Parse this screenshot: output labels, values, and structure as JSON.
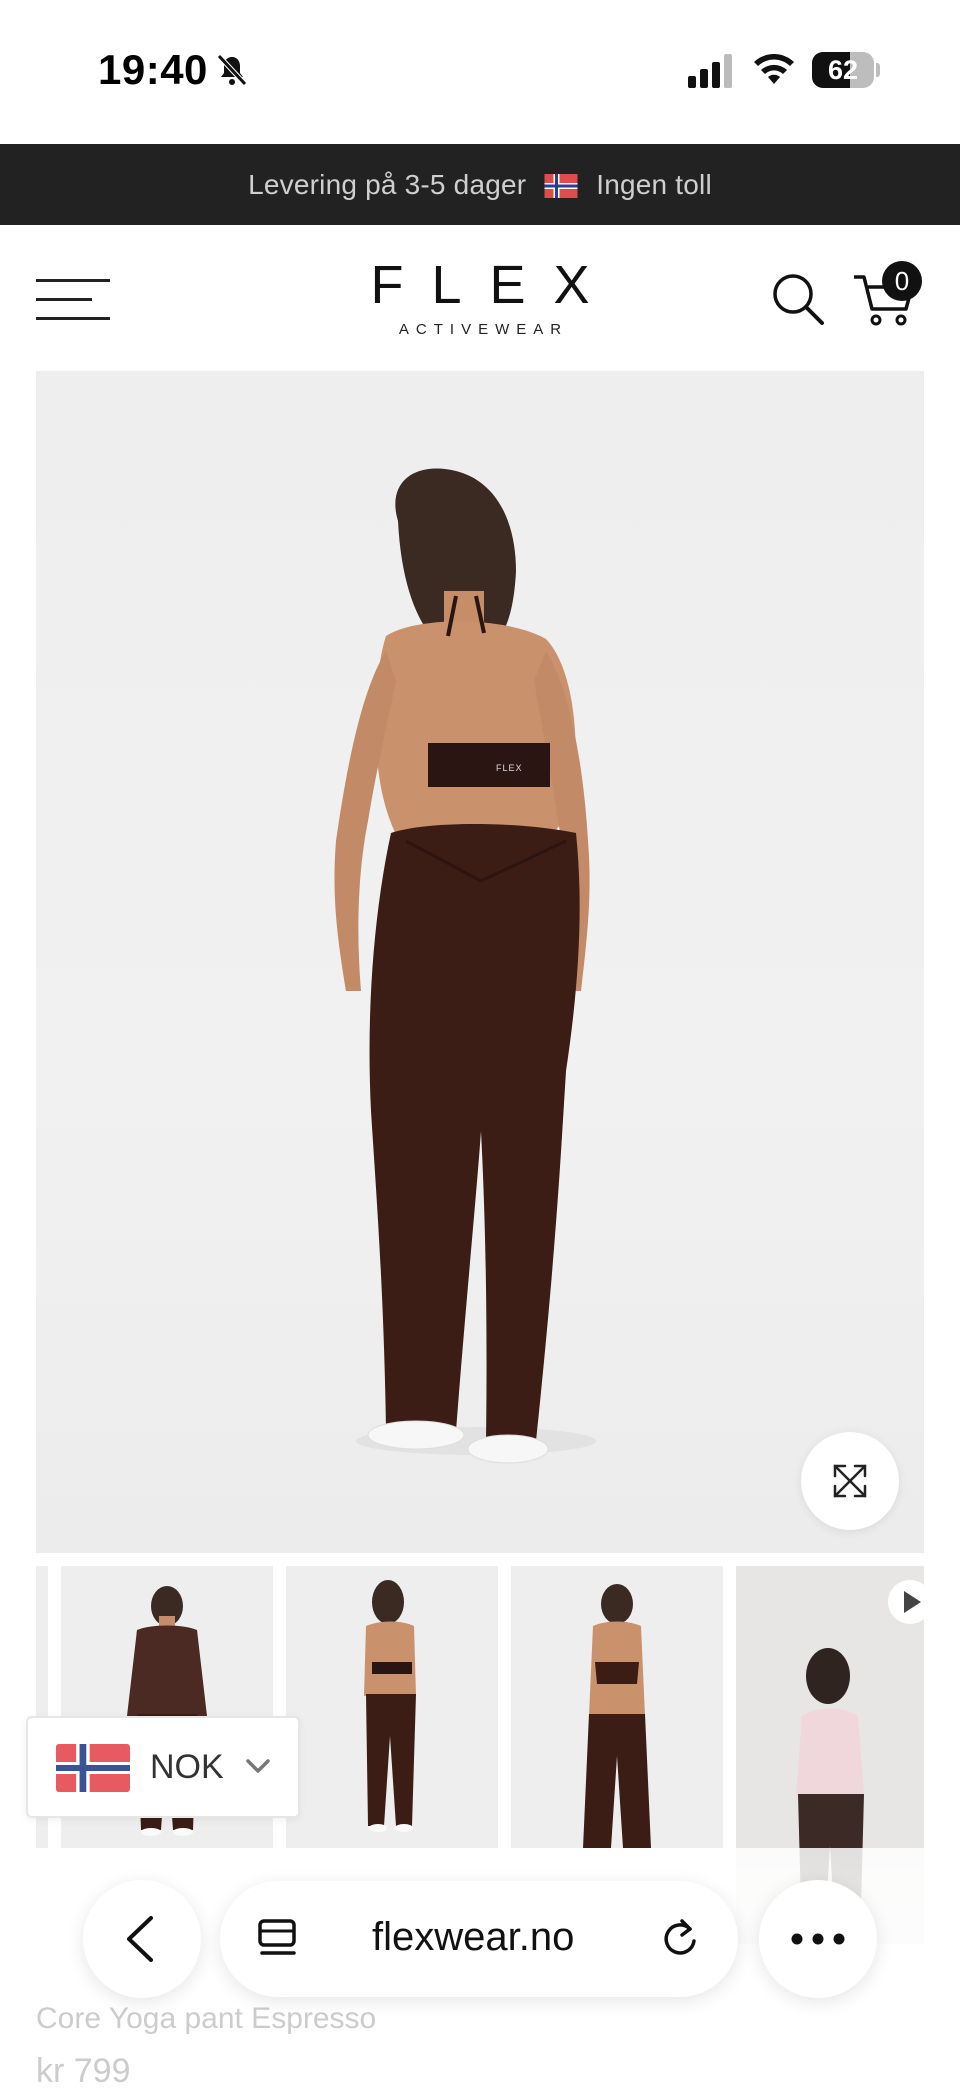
{
  "status_bar": {
    "time": "19:40",
    "battery": "62",
    "battery_level": 0.62
  },
  "announcement": {
    "text_before": "Levering på 3-5 dager",
    "text_after": "Ingen toll"
  },
  "header": {
    "logo": "FLEX",
    "logo_sub": "ACTIVEWEAR",
    "cart_count": "0"
  },
  "gallery": {
    "thumbnails": [
      "thumbnail-front-longsleeve",
      "thumbnail-back-halter",
      "thumbnail-front-halter",
      "thumbnail-video-pink-top"
    ]
  },
  "currency": {
    "code": "NOK"
  },
  "browser": {
    "url": "flexwear.no"
  },
  "product": {
    "title": "Core Yoga pant Espresso",
    "price": "kr 799"
  },
  "colors": {
    "announcement_bg": "#222222",
    "product_brown": "#3b1d16",
    "badge": "#111111"
  }
}
